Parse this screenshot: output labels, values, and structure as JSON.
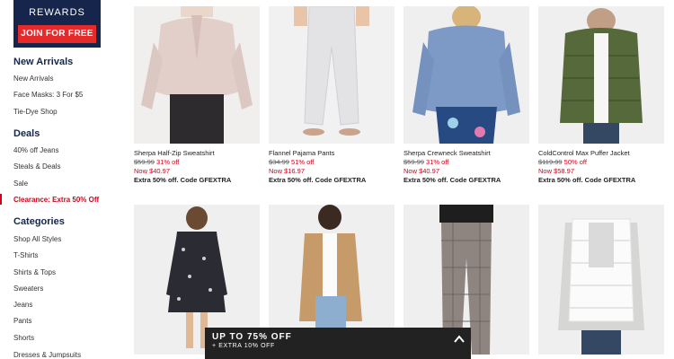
{
  "rewards": {
    "title": "REWARDS",
    "join_label": "JOIN FOR FREE"
  },
  "sidebar": {
    "new_arrivals": {
      "heading": "New Arrivals",
      "items": [
        "New Arrivals",
        "Face Masks: 3 For $5",
        "Tie-Dye Shop"
      ]
    },
    "deals": {
      "heading": "Deals",
      "items": [
        "40% off Jeans",
        "Steals & Deals",
        "Sale",
        "Clearance: Extra 50% Off"
      ]
    },
    "categories": {
      "heading": "Categories",
      "items": [
        "Shop All Styles",
        "T-Shirts",
        "Shirts & Tops",
        "Sweaters",
        "Jeans",
        "Pants",
        "Shorts",
        "Dresses & Jumpsuits"
      ]
    }
  },
  "products": [
    {
      "name": "Sherpa Half-Zip Sweatshirt",
      "old_price": "$59.99",
      "discount": "31% off",
      "now_price": "Now $40.97",
      "promo": "Extra 50% off. Code GFEXTRA"
    },
    {
      "name": "Flannel Pajama Pants",
      "old_price": "$34.99",
      "discount": "51% off",
      "now_price": "Now $16.97",
      "promo": "Extra 50% off. Code GFEXTRA"
    },
    {
      "name": "Sherpa Crewneck Sweatshirt",
      "old_price": "$59.99",
      "discount": "31% off",
      "now_price": "Now $40.97",
      "promo": "Extra 50% off. Code GFEXTRA"
    },
    {
      "name": "ColdControl Max Puffer Jacket",
      "old_price": "$119.99",
      "discount": "50% off",
      "now_price": "Now $58.97",
      "promo": "Extra 50% off. Code GFEXTRA"
    }
  ],
  "promo_bar": {
    "title": "UP TO 75% OFF",
    "subtitle": "+ EXTRA 10% OFF"
  },
  "colors": {
    "navy": "#15254b",
    "red": "#d0021b",
    "promo_bg": "#222222"
  }
}
